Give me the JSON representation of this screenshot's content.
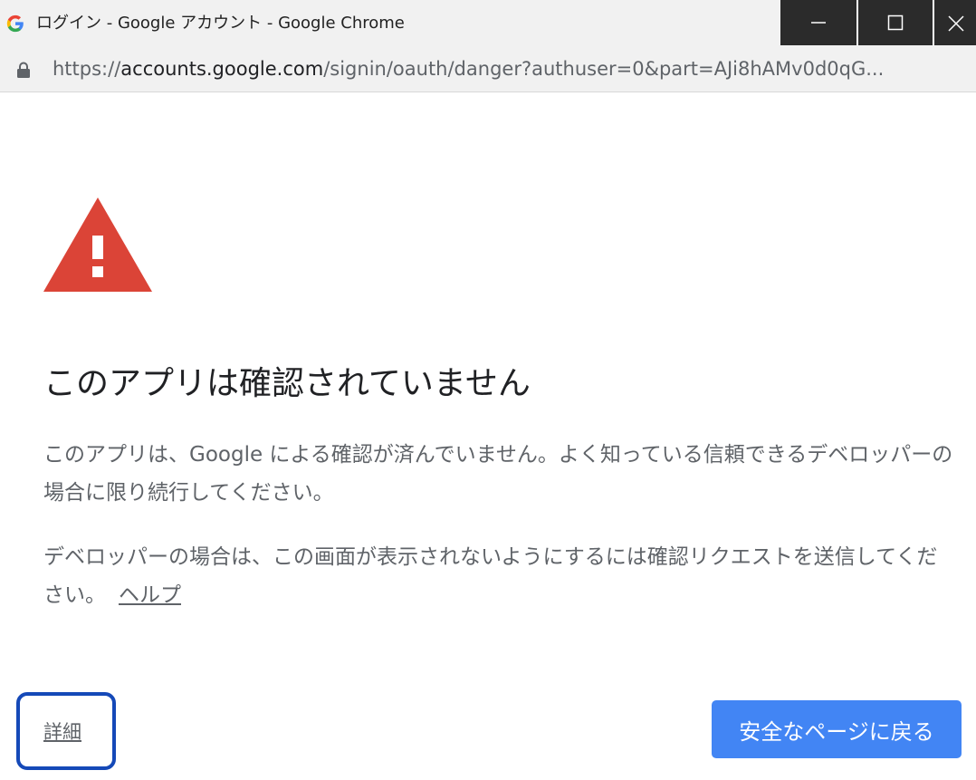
{
  "window": {
    "title": "ログイン - Google アカウント - Google Chrome",
    "controls": [
      "minimize-icon",
      "maximize-icon",
      "close-icon"
    ]
  },
  "address_bar": {
    "scheme": "https://",
    "host": "accounts.google.com",
    "path": "/signin/oauth/danger?authuser=0&part=AJi8hAMv0d0qG..."
  },
  "content": {
    "warning_icon": "warning-triangle-icon",
    "heading": "このアプリは確認されていません",
    "paragraph1": "このアプリは、Google による確認が済んでいません。よく知っている信頼できるデベロッパーの場合に限り続行してください。",
    "paragraph2": "デベロッパーの場合は、この画面が表示されないようにするには確認リクエストを送信してください。",
    "help_link": "ヘルプ",
    "details_link": "詳細",
    "back_button": "安全なページに戻る"
  },
  "colors": {
    "accent": "#4285f4",
    "warning": "#db4437",
    "highlight_box": "#1549b8"
  }
}
